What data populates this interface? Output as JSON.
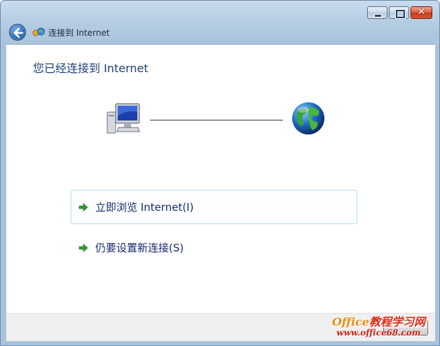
{
  "window": {
    "nav_title": "连接到 Internet",
    "caption": {
      "close_glyph": "✕"
    }
  },
  "main": {
    "heading": "您已经连接到 Internet",
    "links": [
      {
        "label": "立即浏览 Internet(I)"
      },
      {
        "label": "仍要设置新连接(S)"
      }
    ]
  },
  "watermark": {
    "line1_prefix": "Office",
    "line1_suffix": "教程学习网",
    "line2": "www.office68.com"
  },
  "colors": {
    "heading": "#1e3f7a",
    "link_text": "#15296e",
    "arrow_green": "#2e9b2e",
    "hover_border": "#b8e0ef"
  }
}
